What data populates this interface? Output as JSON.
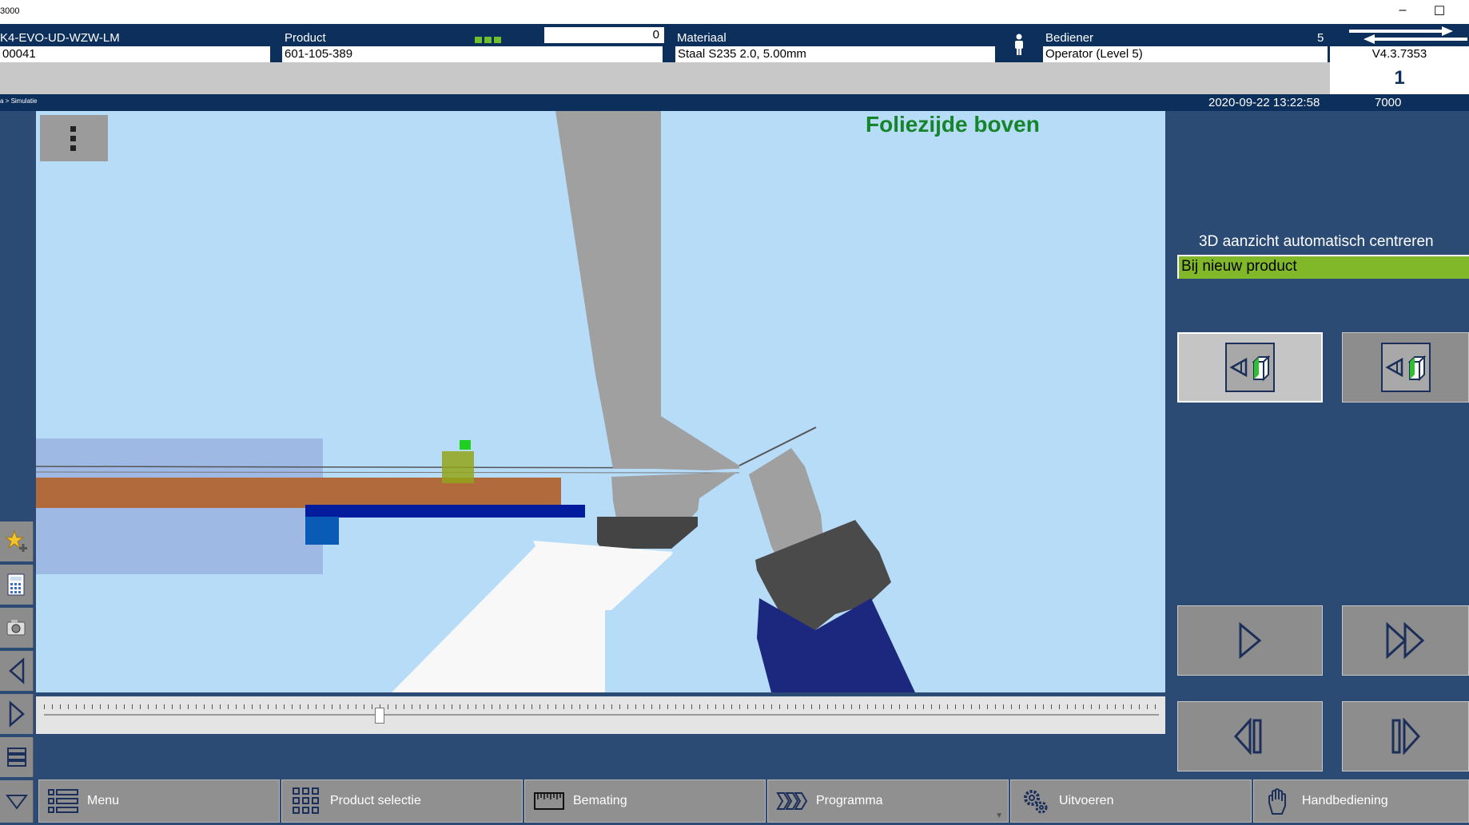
{
  "window": {
    "title": "3000",
    "minimize_glyph": "–",
    "maximize_glyph": "☐"
  },
  "header": {
    "machine_label": "K4-EVO-UD-WZW-LM",
    "machine_value": "00041",
    "product_label": "Product",
    "product_value": "601-105-389",
    "counter_value": "0",
    "material_label": "Materiaal",
    "material_value": "Staal S235 2.0, 5.00mm",
    "operator_label": "Bediener",
    "operator_level": "5",
    "operator_value": "Operator (Level 5)",
    "version": "V4.3.7353",
    "step_number": "1"
  },
  "statusbar": {
    "breadcrumb": "a > Simulatie",
    "datetime": "2020-09-22 13:22:58",
    "code": "7000"
  },
  "viewport": {
    "menu_icon": "vertical-dots-icon",
    "foil_side_label": "Foliezijde boven",
    "slider_position": 0.3
  },
  "right_panel": {
    "auto_center_label": "3D aanzicht automatisch centreren",
    "auto_center_value": "Bij nieuw product"
  },
  "bottom_bar": {
    "menu": "Menu",
    "product_selection": "Product selectie",
    "dimensioning": "Bemating",
    "program": "Programma",
    "execute": "Uitvoeren",
    "manual": "Handbediening"
  },
  "colors": {
    "header_bg": "#0d2f5c",
    "viewport_bg": "#b6dcf8",
    "foil_label": "#16842a",
    "auto_center_bg": "#80b82a",
    "app_bg": "#2b4b75"
  }
}
